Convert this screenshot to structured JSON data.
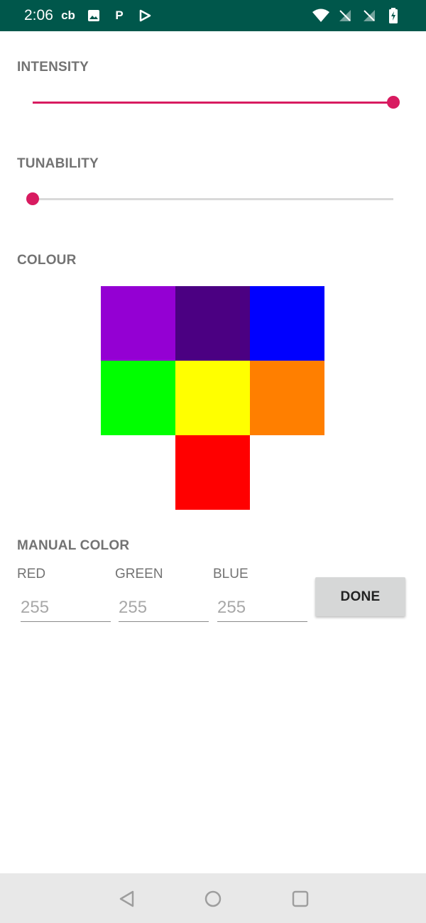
{
  "status_bar": {
    "time": "2:06",
    "left_icons": [
      "cb-app-icon",
      "image-icon",
      "p-app-icon",
      "play-store-icon"
    ],
    "right_icons": [
      "wifi-icon",
      "signal-off-icon",
      "signal-off-icon",
      "battery-charging-icon"
    ],
    "cb_text": "cb",
    "p_text": "P"
  },
  "intensity": {
    "label": "INTENSITY",
    "value_fraction": 1.0
  },
  "tunability": {
    "label": "TUNABILITY",
    "value_fraction": 0.0
  },
  "colour": {
    "label": "COLOUR",
    "swatches": [
      {
        "name": "violet",
        "color": "#9400d3"
      },
      {
        "name": "indigo",
        "color": "#4b0082"
      },
      {
        "name": "blue",
        "color": "#0000ff"
      },
      {
        "name": "green",
        "color": "#00ff00"
      },
      {
        "name": "yellow",
        "color": "#ffff00"
      },
      {
        "name": "orange",
        "color": "#ff7f00"
      },
      {
        "name": "red",
        "color": "#ff0000"
      }
    ]
  },
  "manual_color": {
    "label": "MANUAL COLOR",
    "red_label": "RED",
    "green_label": "GREEN",
    "blue_label": "BLUE",
    "red_placeholder": "255",
    "green_placeholder": "255",
    "blue_placeholder": "255",
    "done_label": "DONE"
  },
  "accent_color": "#d81b60",
  "status_bar_color": "#00574b",
  "nav_bar": {
    "buttons": [
      "back-icon",
      "home-icon",
      "recents-icon"
    ]
  }
}
